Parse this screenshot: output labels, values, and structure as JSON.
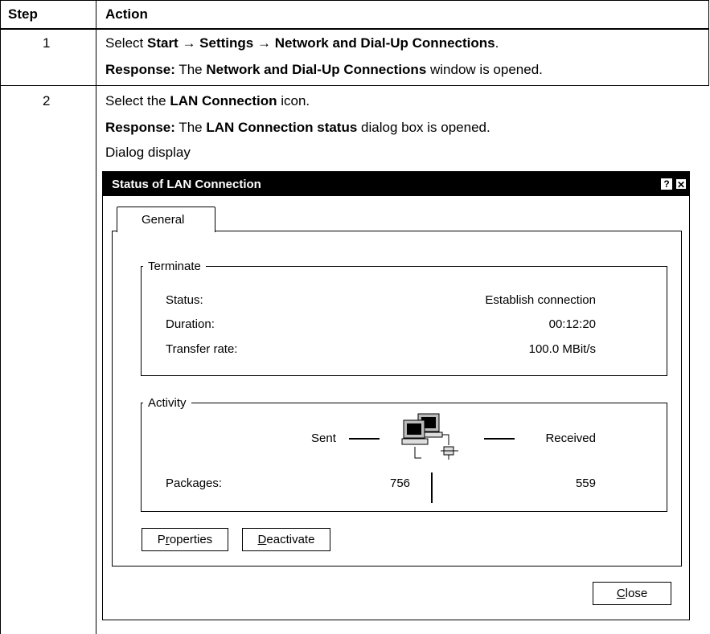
{
  "table": {
    "headers": {
      "step": "Step",
      "action": "Action"
    },
    "rows": [
      {
        "step": "1",
        "line1": {
          "a": "Select ",
          "b1": "Start",
          "c": " → ",
          "b2": "Settings",
          "d": " → ",
          "b3": "Network and Dial-Up Connections",
          "e": "."
        },
        "line2": {
          "b1": "Response:",
          "a": " The ",
          "b2": "Network and Dial-Up Connections",
          "c": " window is opened."
        }
      },
      {
        "step": "2",
        "line1": {
          "a": "Select the ",
          "b1": "LAN Connection",
          "c": " icon."
        },
        "line2": {
          "b1": "Response:",
          "a": " The ",
          "b2": "LAN Connection status",
          "c": " dialog box is opened."
        },
        "line3": "Dialog display"
      }
    ]
  },
  "dialog": {
    "title": "Status of LAN Connection",
    "help_label": "?",
    "close_glyph": "✕",
    "tab_label": "General",
    "terminate": {
      "label": "Terminate",
      "rows": [
        {
          "label": "Status:",
          "value": "Establish connection"
        },
        {
          "label": "Duration:",
          "value": "00:12:20"
        },
        {
          "label": "Transfer rate:",
          "value": "100.0 MBit/s"
        }
      ]
    },
    "activity": {
      "label": "Activity",
      "sent": "Sent",
      "received": "Received",
      "packages_label": "Packages:",
      "packages_sent": "756",
      "packages_received": "559"
    },
    "buttons": {
      "properties": {
        "pre": "P",
        "u": "r",
        "post": "operties"
      },
      "deactivate": {
        "u": "D",
        "post": "eactivate"
      },
      "close": {
        "u": "C",
        "post": "lose"
      }
    }
  }
}
